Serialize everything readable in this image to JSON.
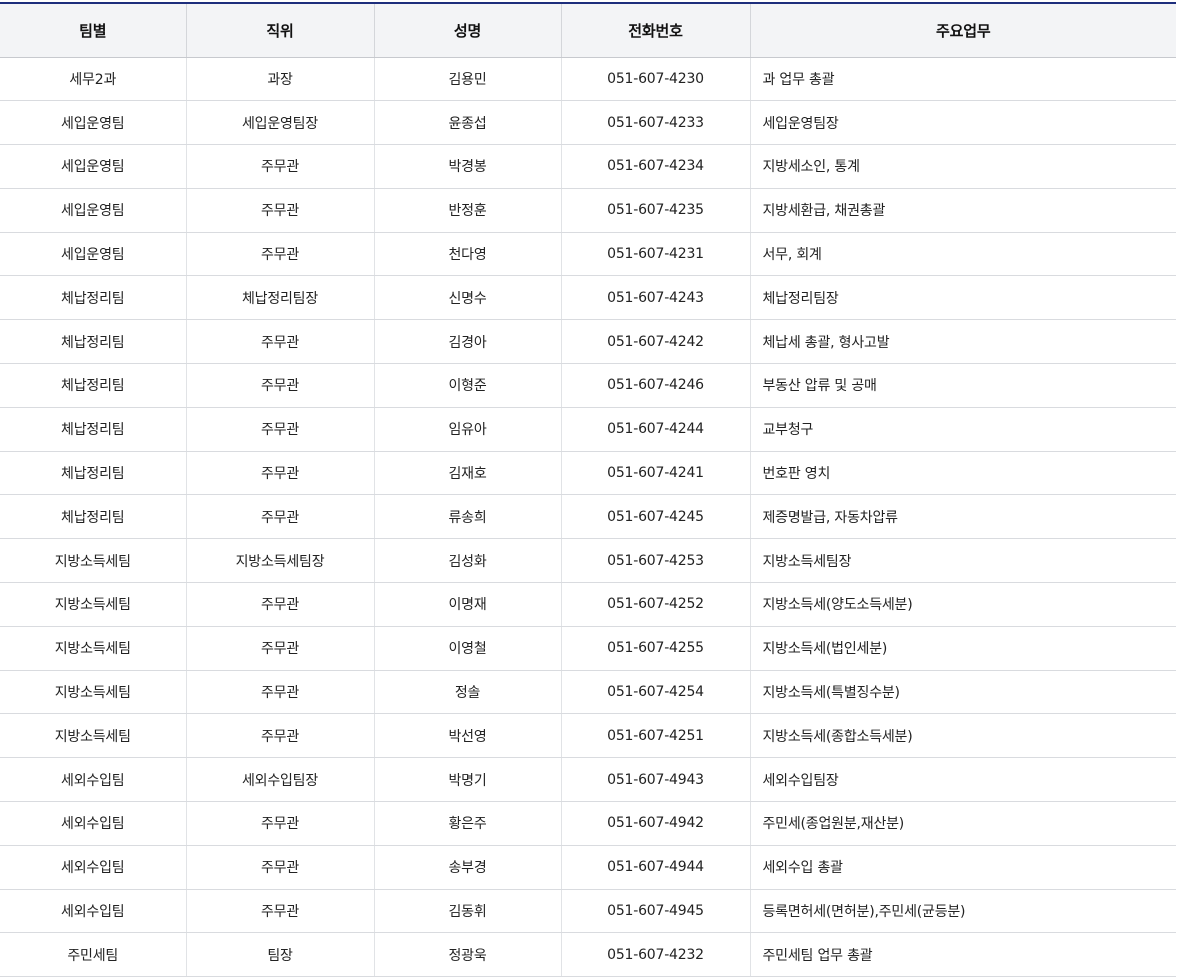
{
  "table": {
    "headers": [
      "팀별",
      "직위",
      "성명",
      "전화번호",
      "주요업무"
    ],
    "rows": [
      [
        "세무2과",
        "과장",
        "김용민",
        "051-607-4230",
        "과 업무 총괄"
      ],
      [
        "세입운영팀",
        "세입운영팀장",
        "윤종섭",
        "051-607-4233",
        "세입운영팀장"
      ],
      [
        "세입운영팀",
        "주무관",
        "박경봉",
        "051-607-4234",
        "지방세소인, 통계"
      ],
      [
        "세입운영팀",
        "주무관",
        "반정훈",
        "051-607-4235",
        "지방세환급, 채권총괄"
      ],
      [
        "세입운영팀",
        "주무관",
        "천다영",
        "051-607-4231",
        "서무, 회계"
      ],
      [
        "체납정리팀",
        "체납정리팀장",
        "신명수",
        "051-607-4243",
        "체납정리팀장"
      ],
      [
        "체납정리팀",
        "주무관",
        "김경아",
        "051-607-4242",
        "체납세 총괄, 형사고발"
      ],
      [
        "체납정리팀",
        "주무관",
        "이형준",
        "051-607-4246",
        "부동산 압류 및 공매"
      ],
      [
        "체납정리팀",
        "주무관",
        "임유아",
        "051-607-4244",
        "교부청구"
      ],
      [
        "체납정리팀",
        "주무관",
        "김재호",
        "051-607-4241",
        "번호판 영치"
      ],
      [
        "체납정리팀",
        "주무관",
        "류송희",
        "051-607-4245",
        "제증명발급, 자동차압류"
      ],
      [
        "지방소득세팀",
        "지방소득세팀장",
        "김성화",
        "051-607-4253",
        "지방소득세팀장"
      ],
      [
        "지방소득세팀",
        "주무관",
        "이명재",
        "051-607-4252",
        "지방소득세(양도소득세분)"
      ],
      [
        "지방소득세팀",
        "주무관",
        "이영철",
        "051-607-4255",
        "지방소득세(법인세분)"
      ],
      [
        "지방소득세팀",
        "주무관",
        "정솔",
        "051-607-4254",
        "지방소득세(특별징수분)"
      ],
      [
        "지방소득세팀",
        "주무관",
        "박선영",
        "051-607-4251",
        "지방소득세(종합소득세분)"
      ],
      [
        "세외수입팀",
        "세외수입팀장",
        "박명기",
        "051-607-4943",
        "세외수입팀장"
      ],
      [
        "세외수입팀",
        "주무관",
        "황은주",
        "051-607-4942",
        "주민세(종업원분,재산분)"
      ],
      [
        "세외수입팀",
        "주무관",
        "송부경",
        "051-607-4944",
        "세외수입 총괄"
      ],
      [
        "세외수입팀",
        "주무관",
        "김동휘",
        "051-607-4945",
        "등록면허세(면허분),주민세(균등분)"
      ],
      [
        "주민세팀",
        "팀장",
        "정광욱",
        "051-607-4232",
        "주민세팀 업무 총괄"
      ]
    ]
  }
}
